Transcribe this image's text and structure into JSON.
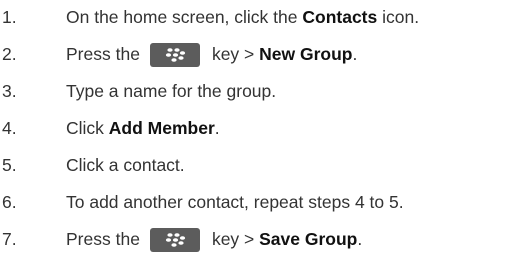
{
  "steps": [
    {
      "number": "1.",
      "parts": {
        "before": "On the home screen, click the ",
        "bold": "Contacts",
        "after": " icon."
      }
    },
    {
      "number": "2.",
      "parts": {
        "before": "Press the",
        "key": "blackberry-menu-key",
        "middle": "key > ",
        "bold": "New Group",
        "after": "."
      }
    },
    {
      "number": "3.",
      "parts": {
        "before": "Type a name for the group."
      }
    },
    {
      "number": "4.",
      "parts": {
        "before": "Click ",
        "bold": "Add Member",
        "after": "."
      }
    },
    {
      "number": "5.",
      "parts": {
        "before": "Click a contact."
      }
    },
    {
      "number": "6.",
      "parts": {
        "before": "To add another contact, repeat steps 4 to 5."
      }
    },
    {
      "number": "7.",
      "parts": {
        "before": "Press the",
        "key": "blackberry-menu-key",
        "middle": "key > ",
        "bold": "Save Group",
        "after": "."
      }
    }
  ],
  "colors": {
    "text": "#333333",
    "key_background": "#5c5c5c",
    "key_glyph": "#ffffff"
  }
}
